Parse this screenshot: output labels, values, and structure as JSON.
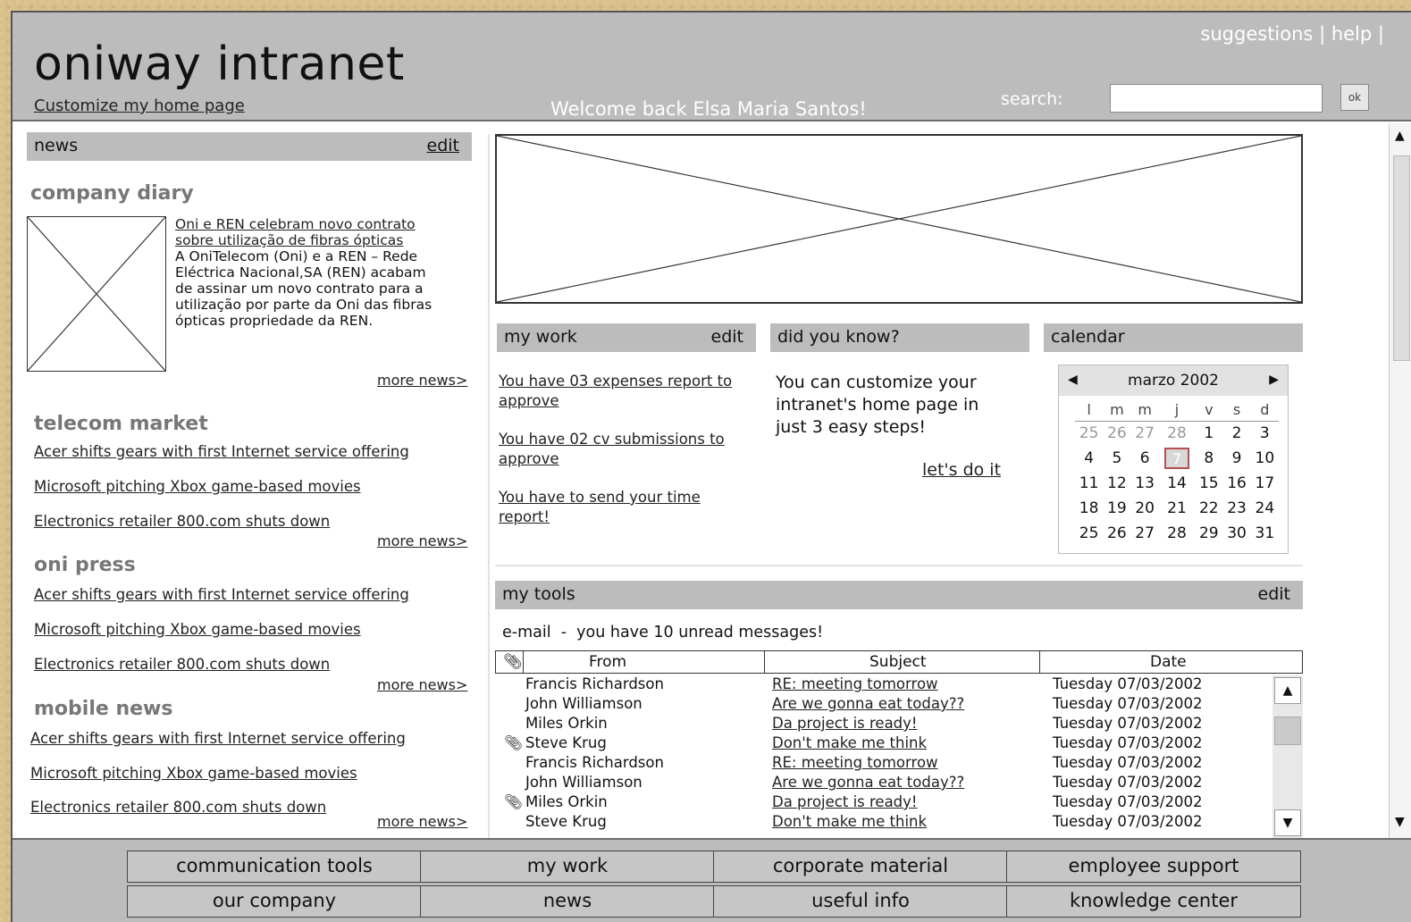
{
  "header": {
    "title": "oniway intranet",
    "customize_link": "Customize my home page",
    "welcome": "Welcome back Elsa Maria Santos!",
    "top_links": [
      "suggestions",
      "help"
    ],
    "search_label": "search:",
    "search_value": "",
    "search_button": "ok"
  },
  "news": {
    "header": "news",
    "edit": "edit",
    "company_diary": {
      "title": "company diary",
      "headline": "Oni e REN celebram novo contrato sobre utilização de fibras ópticas",
      "body": "A OniTelecom (Oni) e a REN – Rede Eléctrica Nacional,SA (REN) acabam de assinar um novo contrato para a utilização por parte da Oni das fibras ópticas propriedade da REN.",
      "more": "more news>"
    },
    "sections": [
      {
        "title": "telecom market",
        "links": [
          "Acer shifts gears with first Internet service offering",
          "Microsoft pitching Xbox game-based movies",
          "Electronics retailer 800.com shuts down"
        ],
        "more": "more news>"
      },
      {
        "title": "oni press",
        "links": [
          "Acer shifts gears with first Internet service offering",
          "Microsoft pitching Xbox game-based movies",
          "Electronics retailer 800.com shuts down"
        ],
        "more": "more news>"
      },
      {
        "title": "mobile news",
        "links": [
          "Acer shifts gears with first Internet service offering",
          "Microsoft pitching Xbox game-based movies",
          "Electronics retailer 800.com shuts down"
        ],
        "more": "more news>"
      }
    ]
  },
  "my_work": {
    "header": "my work",
    "edit": "edit",
    "items": [
      "You have 03 expenses report to approve",
      "You have 02 cv submissions to approve",
      "You have to send your time report!"
    ]
  },
  "did_you_know": {
    "header": "did you know?",
    "text": "You can customize your intranet's home page in just 3 easy steps!",
    "link": "let's do it"
  },
  "calendar": {
    "header": "calendar",
    "month": "marzo 2002",
    "days_of_week": [
      "l",
      "m",
      "m",
      "j",
      "v",
      "s",
      "d"
    ],
    "weeks": [
      [
        "25",
        "26",
        "27",
        "28",
        "1",
        "2",
        "3"
      ],
      [
        "4",
        "5",
        "6",
        "7",
        "8",
        "9",
        "10"
      ],
      [
        "11",
        "12",
        "13",
        "14",
        "15",
        "16",
        "17"
      ],
      [
        "18",
        "19",
        "20",
        "21",
        "22",
        "23",
        "24"
      ],
      [
        "25",
        "26",
        "27",
        "28",
        "29",
        "30",
        "31"
      ]
    ],
    "selected_day": "7"
  },
  "my_tools": {
    "header": "my tools",
    "edit": "edit",
    "email_summary": "e-mail  -  you have 10 unread messages!",
    "columns": [
      "From",
      "Subject",
      "Date"
    ],
    "rows": [
      {
        "attachment": false,
        "from": "Francis Richardson",
        "subject": "RE: meeting tomorrow",
        "date": "Tuesday 07/03/2002"
      },
      {
        "attachment": false,
        "from": "John Williamson",
        "subject": "Are we gonna eat today??",
        "date": "Tuesday 07/03/2002"
      },
      {
        "attachment": false,
        "from": "Miles Orkin",
        "subject": "Da project is ready!",
        "date": "Tuesday 07/03/2002"
      },
      {
        "attachment": true,
        "from": "Steve Krug",
        "subject": "Don't make me think",
        "date": "Tuesday 07/03/2002"
      },
      {
        "attachment": false,
        "from": "Francis Richardson",
        "subject": "RE: meeting tomorrow",
        "date": "Tuesday 07/03/2002"
      },
      {
        "attachment": false,
        "from": "John Williamson",
        "subject": "Are we gonna eat today??",
        "date": "Tuesday 07/03/2002"
      },
      {
        "attachment": true,
        "from": "Miles Orkin",
        "subject": "Da project is ready!",
        "date": "Tuesday 07/03/2002"
      },
      {
        "attachment": false,
        "from": "Steve Krug",
        "subject": "Don't make me think",
        "date": "Tuesday 07/03/2002"
      }
    ]
  },
  "footer_nav": [
    [
      "communication tools",
      "my work",
      "corporate material",
      "employee support"
    ],
    [
      "our company",
      "news",
      "useful info",
      "knowledge center"
    ]
  ],
  "colors": {
    "background": "#d9c08a",
    "header_bar": "#bcbcbc",
    "section_title": "#777777",
    "welcome_text": "#ffffff"
  },
  "icons": {
    "attachment": "paperclip-icon",
    "calendar_prev": "triangle-left-icon",
    "calendar_next": "triangle-right-icon",
    "scroll_up": "triangle-up-icon",
    "scroll_down": "triangle-down-icon"
  }
}
